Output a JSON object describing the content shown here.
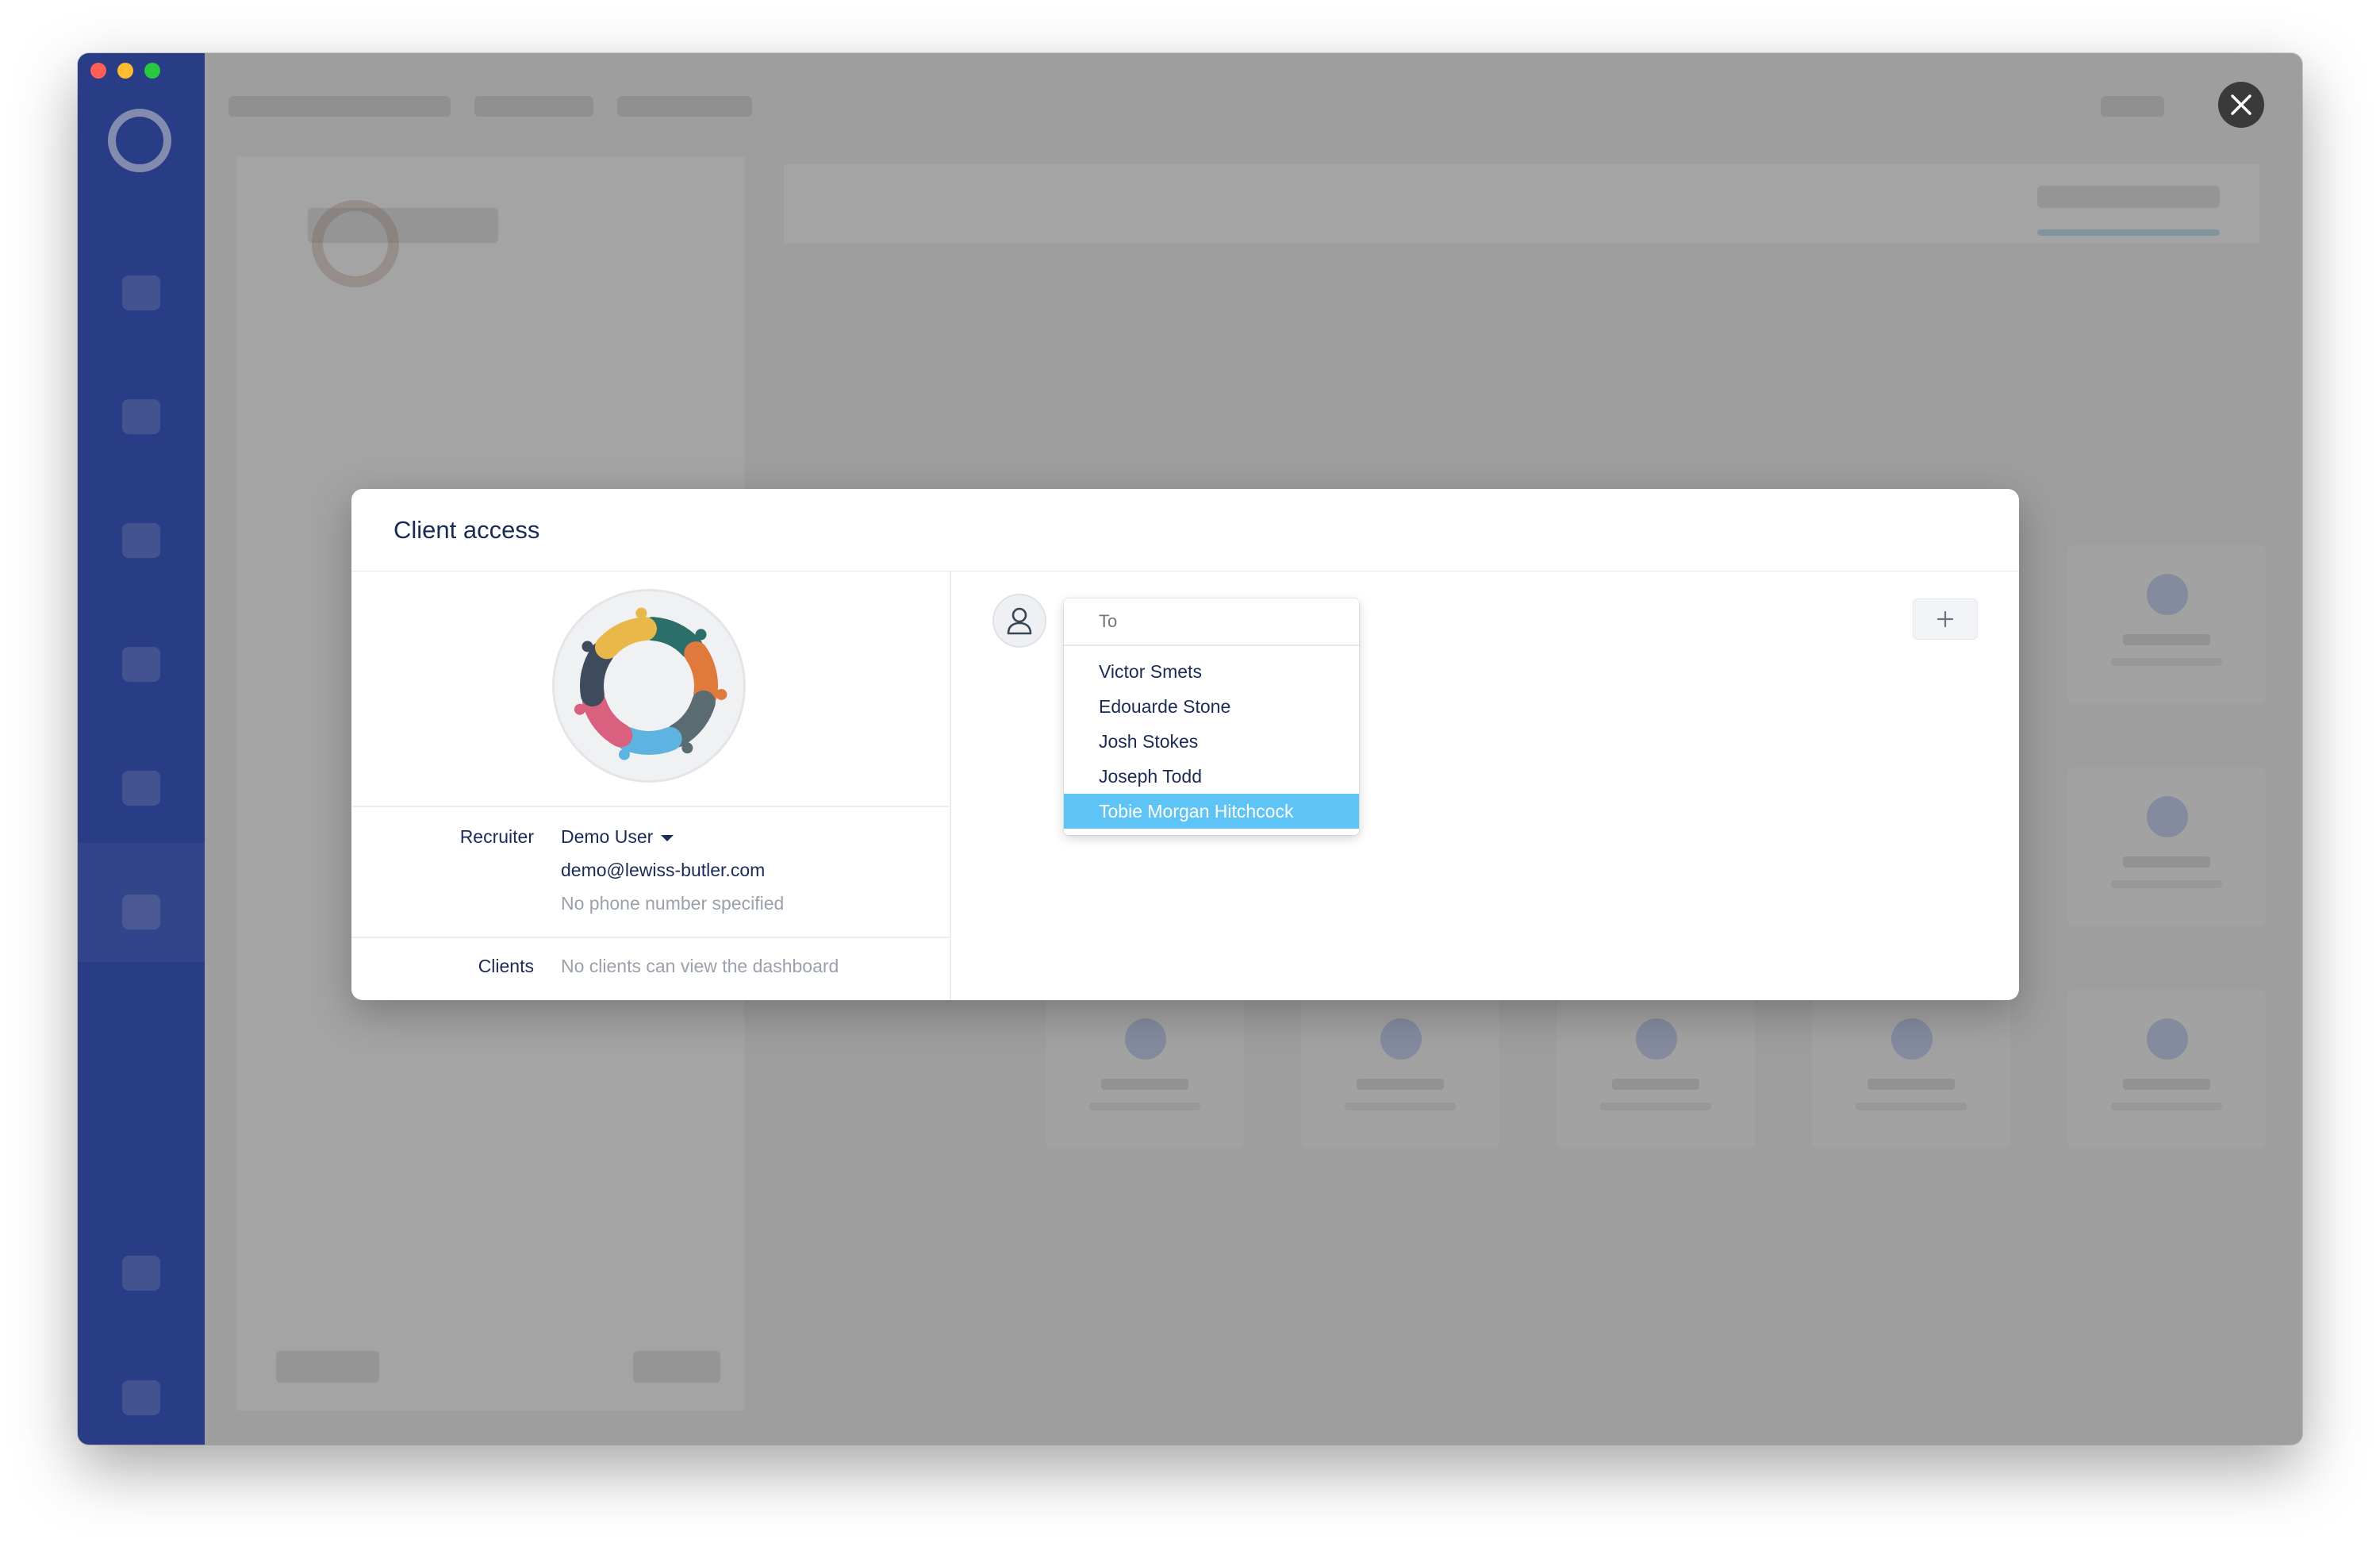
{
  "modal": {
    "title": "Client access",
    "recruiter_label": "Recruiter",
    "recruiter_name": "Demo User",
    "recruiter_email": "demo@lewiss-butler.com",
    "recruiter_phone": "No phone number specified",
    "clients_label": "Clients",
    "clients_value": "No clients can view the dashboard",
    "add_button_icon": "plus-icon",
    "avatar_icon": "user-icon"
  },
  "recipient_dropdown": {
    "placeholder": "To",
    "options": [
      "Victor Smets",
      "Edouarde Stone",
      "Josh Stokes",
      "Joseph Todd",
      "Tobie Morgan Hitchcock"
    ],
    "selected": "Tobie Morgan Hitchcock"
  },
  "window": {
    "close_icon": "close-icon"
  },
  "colors": {
    "sidebar": "#1d3aa3",
    "selection": "#5ec4f5",
    "title_text": "#1a2b55",
    "muted_text": "#9aa1ab",
    "logo_segments": [
      "#2b6e6a",
      "#e07a3c",
      "#5a6b72",
      "#5fb3e0",
      "#d9607f",
      "#3d4b5c",
      "#e9b84a"
    ]
  }
}
